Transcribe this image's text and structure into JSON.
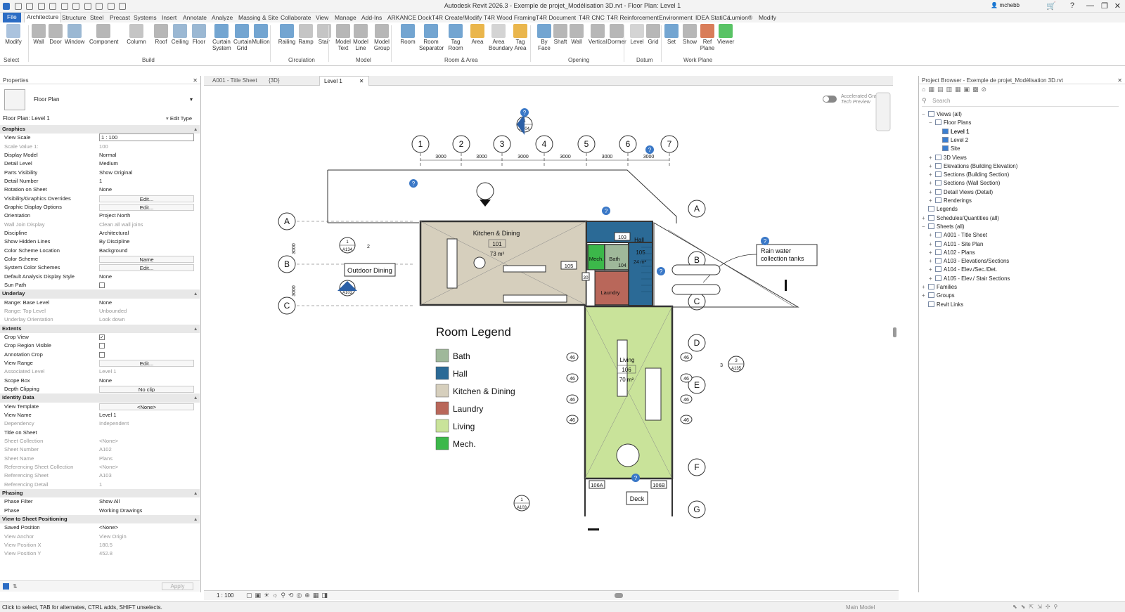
{
  "app": {
    "title": "Autodesk Revit 2026.3 - Exemple de projet_Modélisation 3D.rvt - Floor Plan: Level 1",
    "user": "mchebb"
  },
  "ribbon_tabs": [
    "File",
    "Architecture",
    "Structure",
    "Steel",
    "Precast",
    "Systems",
    "Insert",
    "Annotate",
    "Analyze",
    "Massing & Site",
    "Collaborate",
    "View",
    "Manage",
    "Add-Ins",
    "ARKANCE Dock",
    "T4R Create/Modify",
    "T4R Wood Framing",
    "T4R Document",
    "T4R CNC",
    "T4R Reinforcement",
    "Environment",
    "IDEA StatiCa",
    "Lumion®",
    "Modify"
  ],
  "ribbon": {
    "select": "Select",
    "build": "Build",
    "circulation": "Circulation",
    "model": "Model",
    "room_area": "Room & Area",
    "opening": "Opening",
    "datum": "Datum",
    "work_plane": "Work Plane",
    "buttons": {
      "modify": "Modify",
      "wall": "Wall",
      "door": "Door",
      "window": "Window",
      "component": "Component",
      "column": "Column",
      "roof": "Roof",
      "ceiling": "Ceiling",
      "floor": "Floor",
      "curtain_system": "Curtain System",
      "curtain_grid": "Curtain Grid",
      "mullion": "Mullion",
      "railing": "Railing",
      "ramp": "Ramp",
      "stair": "Stair",
      "model_text": "Model Text",
      "model_line": "Model Line",
      "model_group": "Model Group",
      "room": "Room",
      "room_separator": "Room Separator",
      "tag_room": "Tag Room",
      "area": "Area",
      "area_boundary": "Area Boundary",
      "tag_area": "Tag Area",
      "by_face": "By Face",
      "shaft": "Shaft",
      "wall_opening": "Wall",
      "vertical": "Vertical",
      "dormer": "Dormer",
      "level": "Level",
      "grid": "Grid",
      "set": "Set",
      "show": "Show",
      "ref_plane": "Ref Plane",
      "viewer": "Viewer"
    }
  },
  "properties": {
    "title": "Properties",
    "type_name": "Floor Plan",
    "selector": "Floor Plan: Level 1",
    "edit_type": "Edit Type",
    "apply": "Apply",
    "rows": [
      {
        "k": "Graphics",
        "sect": true
      },
      {
        "k": "View Scale",
        "v": "1 : 100",
        "box": true
      },
      {
        "k": "Scale Value    1:",
        "v": "100",
        "dim": true
      },
      {
        "k": "Display Model",
        "v": "Normal"
      },
      {
        "k": "Detail Level",
        "v": "Medium"
      },
      {
        "k": "Parts Visibility",
        "v": "Show Original"
      },
      {
        "k": "Detail Number",
        "v": "1"
      },
      {
        "k": "Rotation on Sheet",
        "v": "None"
      },
      {
        "k": "Visibility/Graphics Overrides",
        "v": "Edit...",
        "btn": true
      },
      {
        "k": "Graphic Display Options",
        "v": "Edit...",
        "btn": true
      },
      {
        "k": "Orientation",
        "v": "Project North"
      },
      {
        "k": "Wall Join Display",
        "v": "Clean all wall joins",
        "dim": true
      },
      {
        "k": "Discipline",
        "v": "Architectural"
      },
      {
        "k": "Show Hidden Lines",
        "v": "By Discipline"
      },
      {
        "k": "Color Scheme Location",
        "v": "Background"
      },
      {
        "k": "Color Scheme",
        "v": "Name",
        "btn": true
      },
      {
        "k": "System Color Schemes",
        "v": "Edit...",
        "btn": true
      },
      {
        "k": "Default Analysis Display Style",
        "v": "None"
      },
      {
        "k": "Sun Path",
        "chk": false
      },
      {
        "k": "Underlay",
        "sect": true
      },
      {
        "k": "Range: Base Level",
        "v": "None"
      },
      {
        "k": "Range: Top Level",
        "v": "Unbounded",
        "dim": true
      },
      {
        "k": "Underlay Orientation",
        "v": "Look down",
        "dim": true
      },
      {
        "k": "Extents",
        "sect": true
      },
      {
        "k": "Crop View",
        "chk": true
      },
      {
        "k": "Crop Region Visible",
        "chk": false
      },
      {
        "k": "Annotation Crop",
        "chk": false
      },
      {
        "k": "View Range",
        "v": "Edit...",
        "btn": true
      },
      {
        "k": "Associated Level",
        "v": "Level 1",
        "dim": true
      },
      {
        "k": "Scope Box",
        "v": "None"
      },
      {
        "k": "Depth Clipping",
        "v": "No clip",
        "btn": true
      },
      {
        "k": "Identity Data",
        "sect": true
      },
      {
        "k": "View Template",
        "v": "<None>",
        "btn": true
      },
      {
        "k": "View Name",
        "v": "Level 1"
      },
      {
        "k": "Dependency",
        "v": "Independent",
        "dim": true
      },
      {
        "k": "Title on Sheet",
        "v": ""
      },
      {
        "k": "Sheet Collection",
        "v": "<None>",
        "dim": true
      },
      {
        "k": "Sheet Number",
        "v": "A102",
        "dim": true
      },
      {
        "k": "Sheet Name",
        "v": "Plans",
        "dim": true
      },
      {
        "k": "Referencing Sheet Collection",
        "v": "<None>",
        "dim": true
      },
      {
        "k": "Referencing Sheet",
        "v": "A103",
        "dim": true
      },
      {
        "k": "Referencing Detail",
        "v": "1",
        "dim": true
      },
      {
        "k": "Phasing",
        "sect": true
      },
      {
        "k": "Phase Filter",
        "v": "Show All"
      },
      {
        "k": "Phase",
        "v": "Working Drawings"
      },
      {
        "k": "View to Sheet Positioning",
        "sect": true
      },
      {
        "k": "Saved Position",
        "v": "<None>"
      },
      {
        "k": "View Anchor",
        "v": "View Origin",
        "dim": true
      },
      {
        "k": "View Position X",
        "v": "180.5",
        "dim": true
      },
      {
        "k": "View Position Y",
        "v": "452.8",
        "dim": true
      }
    ]
  },
  "view_tabs": [
    "A001 - Title Sheet",
    "{3D}",
    "Level 1"
  ],
  "view_bar": {
    "scale": "1 : 100"
  },
  "accel": {
    "line1": "Accelerated Graphics",
    "line2": "Tech Preview"
  },
  "plan": {
    "grid_cols": [
      "1",
      "2",
      "3",
      "4",
      "5",
      "6",
      "7"
    ],
    "grid_rows": [
      "A",
      "B",
      "C",
      "D",
      "E",
      "F",
      "G"
    ],
    "dims_top": [
      "3000",
      "3000",
      "3000",
      "3000",
      "3000",
      "3000"
    ],
    "dims_left": [
      "3000",
      "3000"
    ],
    "rooms": [
      {
        "name": "Kitchen & Dining",
        "number": "101",
        "area": "73 m²"
      },
      {
        "name": "Hall",
        "number": "105",
        "area": "24 m²"
      },
      {
        "name": "Mech.",
        "number": "",
        "area": ""
      },
      {
        "name": "Bath",
        "number": "104",
        "area": ""
      },
      {
        "name": "Laundry",
        "number": "",
        "area": ""
      },
      {
        "name": "Living",
        "number": "106",
        "area": "70 m²"
      }
    ],
    "tags": {
      "outdoor_dining": "Outdoor Dining",
      "rain_water_1": "Rain water",
      "rain_water_2": "collection tanks",
      "deck": "Deck",
      "door_105": "105",
      "door_106a": "106A",
      "door_106b": "106B",
      "door_30": "30",
      "door_46": "46",
      "door_103": "103"
    },
    "section_marks": [
      {
        "num": "1",
        "sheet": "A104"
      },
      {
        "num": "1",
        "sheet": "A134"
      },
      {
        "num": "3",
        "sheet": "A103"
      },
      {
        "num": "3",
        "sheet": "A135"
      },
      {
        "num": "1",
        "sheet": "A103"
      }
    ],
    "section_side_labels": {
      "a134": "2",
      "a135": "3"
    }
  },
  "legend": {
    "title": "Room Legend",
    "items": [
      {
        "name": "Bath",
        "color": "#9fb89a"
      },
      {
        "name": "Hall",
        "color": "#2b6a96"
      },
      {
        "name": "Kitchen & Dining",
        "color": "#d6cfbd"
      },
      {
        "name": "Laundry",
        "color": "#b9675a"
      },
      {
        "name": "Living",
        "color": "#c9e39a"
      },
      {
        "name": "Mech.",
        "color": "#3cb84a"
      }
    ]
  },
  "browser": {
    "title": "Project Browser - Exemple de projet_Modélisation 3D.rvt",
    "search": "Search",
    "items": [
      {
        "t": "Views (all)",
        "lvl": 0,
        "ex": "−"
      },
      {
        "t": "Floor Plans",
        "lvl": 1,
        "ex": "−"
      },
      {
        "t": "Level 1",
        "lvl": 2,
        "ex": "",
        "bold": true
      },
      {
        "t": "Level 2",
        "lvl": 2,
        "ex": ""
      },
      {
        "t": "Site",
        "lvl": 2,
        "ex": ""
      },
      {
        "t": "3D Views",
        "lvl": 1,
        "ex": "+"
      },
      {
        "t": "Elevations (Building Elevation)",
        "lvl": 1,
        "ex": "+"
      },
      {
        "t": "Sections (Building Section)",
        "lvl": 1,
        "ex": "+"
      },
      {
        "t": "Sections (Wall Section)",
        "lvl": 1,
        "ex": "+"
      },
      {
        "t": "Detail Views (Detail)",
        "lvl": 1,
        "ex": "+"
      },
      {
        "t": "Renderings",
        "lvl": 1,
        "ex": "+"
      },
      {
        "t": "Legends",
        "lvl": 0,
        "ex": ""
      },
      {
        "t": "Schedules/Quantities (all)",
        "lvl": 0,
        "ex": "+"
      },
      {
        "t": "Sheets (all)",
        "lvl": 0,
        "ex": "−"
      },
      {
        "t": "A001 - Title Sheet",
        "lvl": 1,
        "ex": "+"
      },
      {
        "t": "A101 - Site Plan",
        "lvl": 1,
        "ex": "+"
      },
      {
        "t": "A102 - Plans",
        "lvl": 1,
        "ex": "+"
      },
      {
        "t": "A103 - Elevations/Sections",
        "lvl": 1,
        "ex": "+"
      },
      {
        "t": "A104 - Elev./Sec./Det.",
        "lvl": 1,
        "ex": "+"
      },
      {
        "t": "A105 - Elev./ Stair Sections",
        "lvl": 1,
        "ex": "+"
      },
      {
        "t": "Families",
        "lvl": 0,
        "ex": "+"
      },
      {
        "t": "Groups",
        "lvl": 0,
        "ex": "+"
      },
      {
        "t": "Revit Links",
        "lvl": 0,
        "ex": ""
      }
    ]
  },
  "status": {
    "hint": "Click to select, TAB for alternates, CTRL adds, SHIFT unselects.",
    "model": "Main Model"
  }
}
